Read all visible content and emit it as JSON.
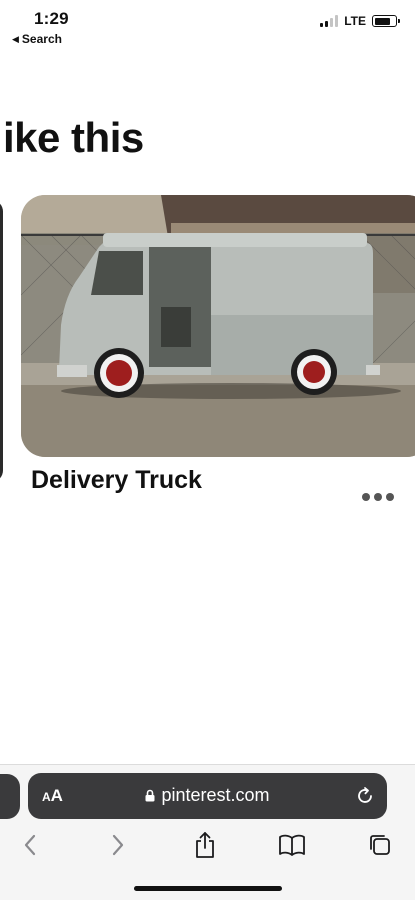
{
  "status_bar": {
    "time": "1:29",
    "back_label": "Search",
    "network": "LTE"
  },
  "content": {
    "heading": "ike this",
    "card": {
      "title": "Delivery Truck",
      "image_alt": "Photo of a vintage gray delivery truck with red wheels"
    }
  },
  "browser": {
    "aa_small": "A",
    "aa_large": "A",
    "url": "pinterest.com"
  },
  "colors": {
    "pill": "#3a3a3c",
    "toolbar_bg": "#f5f5f5",
    "icon": "#1c1c1e"
  }
}
